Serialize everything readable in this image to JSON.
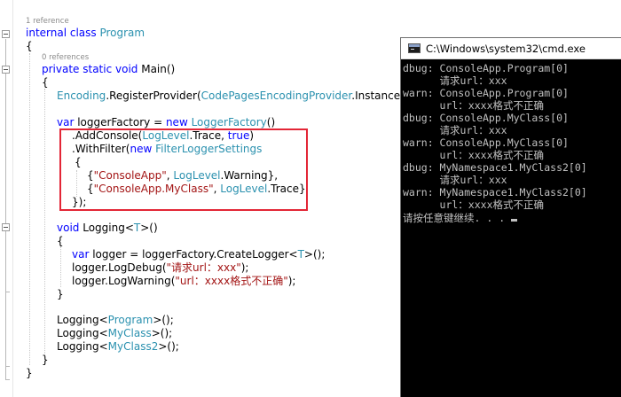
{
  "editor": {
    "codelens_class": "1 reference",
    "codelens_main": "0 references",
    "lines": {
      "class_decl": {
        "kw": "internal class ",
        "name": "Program"
      },
      "open1": "{",
      "main_decl": {
        "kw": "private static void ",
        "name": "Main()"
      },
      "open2": "{",
      "register": {
        "t1": "Encoding",
        "m1": ".RegisterProvider(",
        "t2": "CodePagesEncodingProvider",
        "m2": ".Instance);"
      },
      "factory": {
        "kw1": "var ",
        "m1": "loggerFactory = ",
        "kw2": "new ",
        "t1": "LoggerFactory",
        "m2": "()"
      },
      "add_console": {
        "m1": ".AddConsole(",
        "t1": "LogLevel",
        "m2": ".Trace, ",
        "kw1": "true",
        "m3": ")"
      },
      "with_filter": {
        "m1": ".WithFilter(",
        "kw1": "new ",
        "t1": "FilterLoggerSettings"
      },
      "open3": "{",
      "filter1": {
        "m1": "{",
        "s1": "\"ConsoleApp\"",
        "m2": ", ",
        "t1": "LogLevel",
        "m3": ".Warning},"
      },
      "filter2": {
        "m1": "{",
        "s1": "\"ConsoleApp.MyClass\"",
        "m2": ", ",
        "t1": "LogLevel",
        "m3": ".Trace}"
      },
      "close3": "});",
      "logging_decl": {
        "kw1": "void ",
        "m1": "Logging<",
        "t1": "T",
        "m2": ">()"
      },
      "open4": "{",
      "create_logger": {
        "kw1": "var ",
        "m1": "logger = loggerFactory.CreateLogger<",
        "t1": "T",
        "m2": ">();"
      },
      "log_debug": {
        "m1": "logger.LogDebug(",
        "s1": "\"请求url：xxx\"",
        "m2": ");"
      },
      "log_warning": {
        "m1": "logger.LogWarning(",
        "s1": "\"url：xxxx格式不正确\"",
        "m2": ");"
      },
      "close4": "}",
      "call1": {
        "m1": "Logging<",
        "t1": "Program",
        "m2": ">();"
      },
      "call2": {
        "m1": "Logging<",
        "t1": "MyClass",
        "m2": ">();"
      },
      "call3": {
        "m1": "Logging<",
        "t1": "MyClass2",
        "m2": ">();"
      },
      "close2": "}",
      "close1": "}"
    }
  },
  "console": {
    "title": "C:\\Windows\\system32\\cmd.exe",
    "icon": "console-window-icon",
    "lines": [
      "dbug: ConsoleApp.Program[0]",
      "      请求url：xxx",
      "warn: ConsoleApp.Program[0]",
      "      url：xxxx格式不正确",
      "dbug: ConsoleApp.MyClass[0]",
      "      请求url：xxx",
      "warn: ConsoleApp.MyClass[0]",
      "      url：xxxx格式不正确",
      "dbug: MyNamespace1.MyClass2[0]",
      "      请求url：xxx",
      "warn: MyNamespace1.MyClass2[0]",
      "      url：xxxx格式不正确",
      "请按任意键继续. . . "
    ]
  },
  "colors": {
    "keyword": "#0000ff",
    "type": "#2b91af",
    "string": "#a31515",
    "highlight_box": "#e32636",
    "console_bg": "#000000",
    "console_text": "#c0c0c0"
  }
}
